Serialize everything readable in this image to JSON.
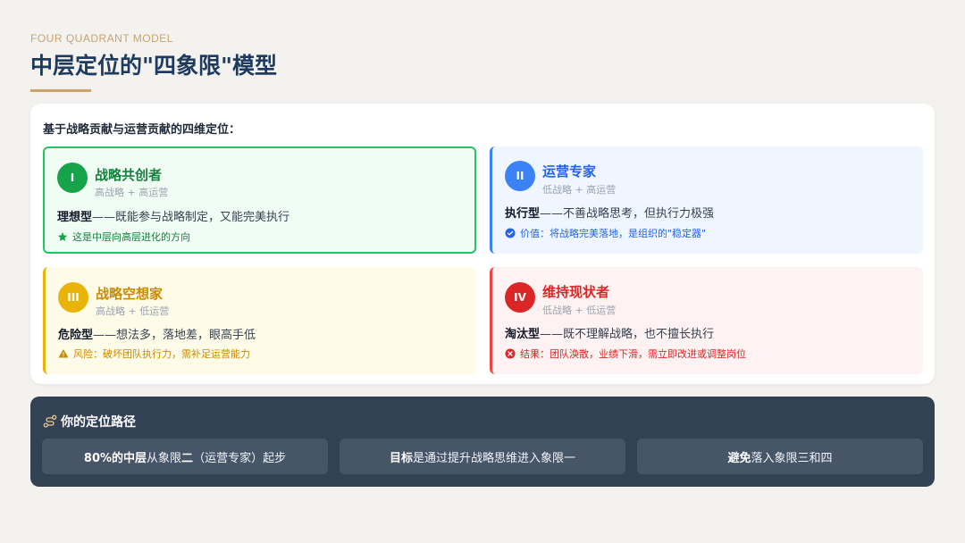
{
  "header": {
    "eyebrow": "FOUR QUADRANT MODEL",
    "title": "中层定位的\"四象限\"模型"
  },
  "main": {
    "intro": "基于战略贡献与运营贡献的四维定位：",
    "quadrants": [
      {
        "numeral": "I",
        "title": "战略共创者",
        "subtitle": "高战略 + 高运营",
        "type": "理想型",
        "desc": "——既能参与战略制定，又能完美执行",
        "note_icon": "star-icon",
        "note": "这是中层向高层进化的方向",
        "color": "#16a34a"
      },
      {
        "numeral": "II",
        "title": "运营专家",
        "subtitle": "低战略 + 高运营",
        "type": "执行型",
        "desc": "——不善战略思考，但执行力极强",
        "note_icon": "check-circle-icon",
        "note": "价值：将战略完美落地，是组织的\"稳定器\"",
        "color": "#3b82f6"
      },
      {
        "numeral": "III",
        "title": "战略空想家",
        "subtitle": "高战略 + 低运营",
        "type": "危险型",
        "desc": "——想法多，落地差，眼高手低",
        "note_icon": "warning-icon",
        "note": "风险：破坏团队执行力，需补足运营能力",
        "color": "#eab308"
      },
      {
        "numeral": "IV",
        "title": "维持现状者",
        "subtitle": "低战略 + 低运营",
        "type": "淘汰型",
        "desc": "——既不理解战略，也不擅长执行",
        "note_icon": "x-circle-icon",
        "note": "结果：团队涣散，业绩下滑，需立即改进或调整岗位",
        "color": "#dc2626"
      }
    ]
  },
  "path": {
    "icon": "route-icon",
    "title": "你的定位路径",
    "steps": [
      {
        "bold": "80%的中层",
        "pre": "从象限",
        "bold2": "二",
        "rest": "（运营专家）起步"
      },
      {
        "bold": "目标",
        "rest": "是通过提升战略思维进入象限一"
      },
      {
        "bold": "避免",
        "rest": "落入象限三和四"
      }
    ]
  }
}
